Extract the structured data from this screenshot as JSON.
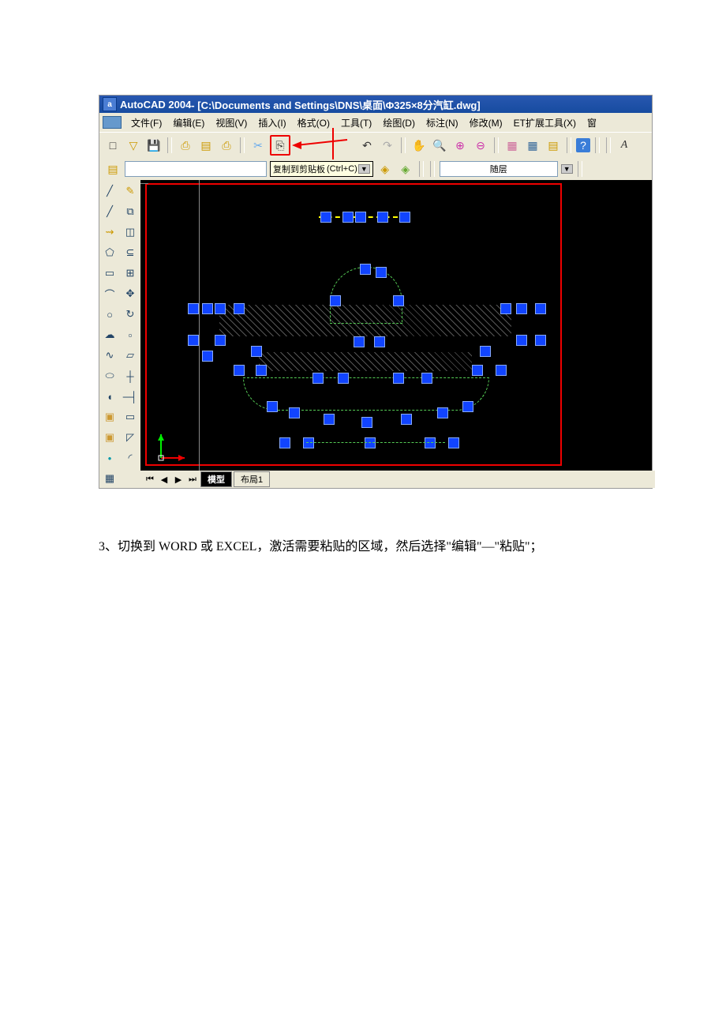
{
  "titlebar": {
    "app": "AutoCAD 2004",
    "path": " - [C:\\Documents and Settings\\DNS\\桌面\\Φ325×8分汽缸.dwg]"
  },
  "menu": {
    "file": "文件(F)",
    "edit": "编辑(E)",
    "view": "视图(V)",
    "insert": "插入(I)",
    "format": "格式(O)",
    "tools": "工具(T)",
    "draw": "绘图(D)",
    "dim": "标注(N)",
    "modify": "修改(M)",
    "et": "ET扩展工具(X)",
    "window": "窗"
  },
  "tooltip": {
    "text": "复制到剪贴板",
    "shortcut": "(Ctrl+C)"
  },
  "layer": {
    "bylayer": "随层"
  },
  "tabs": {
    "model": "模型",
    "layout1": "布局1"
  },
  "caption": {
    "text": "3、切换到 WORD 或 EXCEL，激活需要粘贴的区域，然后选择\"编辑\"—\"粘贴\"；"
  },
  "icons": {
    "new": "□",
    "open": "▽",
    "save": "💾",
    "print": "⎙",
    "plot": "▤",
    "cut": "✂",
    "copy": "⎘",
    "undo": "↶",
    "redo": "↷",
    "pan": "✋",
    "zoom": "🔍",
    "help": "?",
    "txt": "A"
  }
}
